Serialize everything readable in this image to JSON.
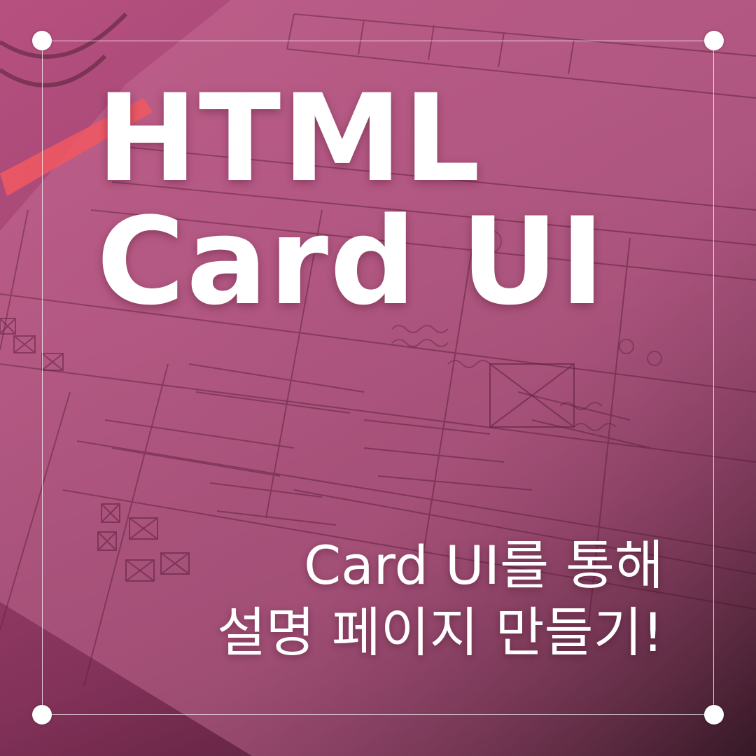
{
  "title": {
    "line1": "HTML",
    "line2": "Card UI"
  },
  "subtitle": {
    "line1": "Card UI를 통해",
    "line2": "설명 페이지 만들기!"
  },
  "colors": {
    "overlay_top": "#b24d7c",
    "overlay_bottom": "#3a1424",
    "frame": "#ffffff",
    "text": "#ffffff",
    "pencil": "#ff5a5a"
  }
}
